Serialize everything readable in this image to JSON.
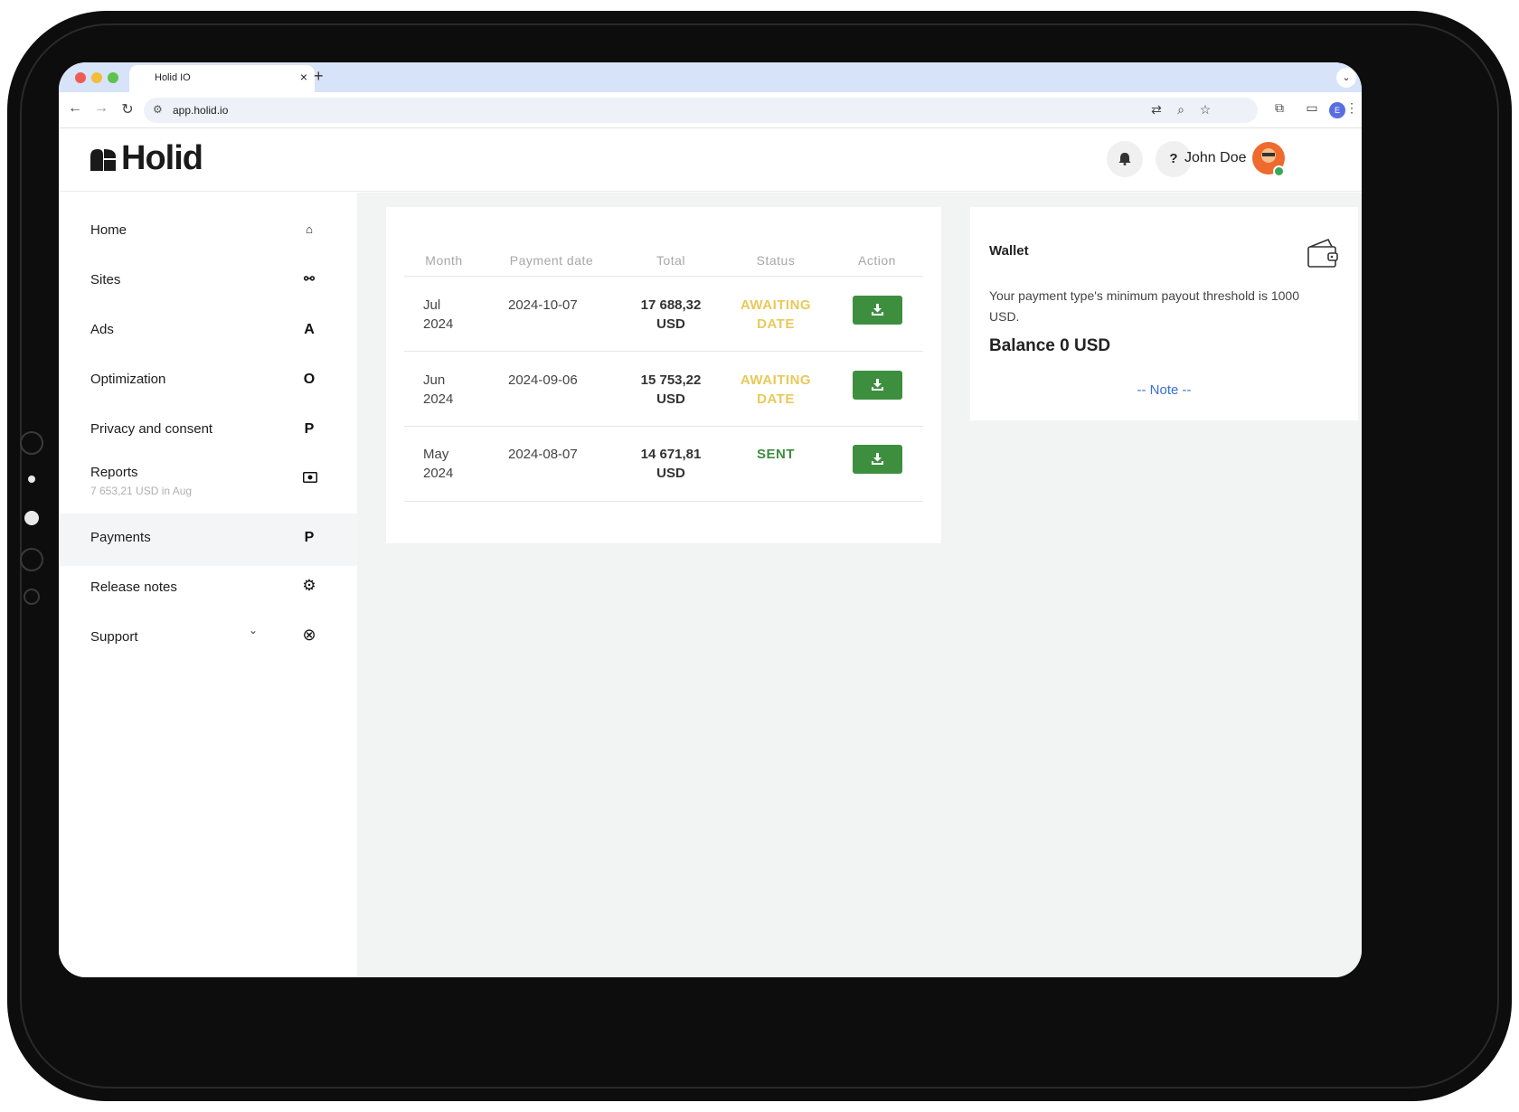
{
  "browser": {
    "tab_title": "Holid IO",
    "tab_close": "×",
    "new_tab": "+",
    "tab_menu": "⌄",
    "url": "app.holid.io",
    "profile_initial": "E"
  },
  "header": {
    "logo_text": "Holid",
    "notifications_icon": "bell-icon",
    "help_label": "?",
    "user_name": "John Doe"
  },
  "sidebar": {
    "items": [
      {
        "label": "Home",
        "icon": "🏠"
      },
      {
        "label": "Sites",
        "icon": "🔗"
      },
      {
        "label": "Ads",
        "icon": "A"
      },
      {
        "label": "Optimization",
        "icon": "O"
      },
      {
        "label": "Privacy and consent",
        "icon": "P"
      },
      {
        "label": "Reports",
        "sublabel": "7 653,21 USD in Aug",
        "icon": "💵"
      },
      {
        "label": "Payments",
        "icon": "P",
        "active": true
      },
      {
        "label": "Release notes",
        "icon": "⚙"
      },
      {
        "label": "Support",
        "icon": "⊛",
        "chevron": "⌄"
      }
    ]
  },
  "payments": {
    "columns": [
      "Month",
      "Payment date",
      "Total",
      "Status",
      "Action"
    ],
    "rows": [
      {
        "month": "Jul",
        "year": "2024",
        "date": "2024-10-07",
        "amount": "17 688,32",
        "currency": "USD",
        "status_line1": "AWAITING",
        "status_line2": "DATE",
        "status_color": "#e8c95a"
      },
      {
        "month": "Jun",
        "year": "2024",
        "date": "2024-09-06",
        "amount": "15 753,22",
        "currency": "USD",
        "status_line1": "AWAITING",
        "status_line2": "DATE",
        "status_color": "#e8c95a"
      },
      {
        "month": "May",
        "year": "2024",
        "date": "2024-08-07",
        "amount": "14 671,81",
        "currency": "USD",
        "status_line1": "SENT",
        "status_line2": "",
        "status_color": "#3d8f3f"
      }
    ]
  },
  "wallet": {
    "title": "Wallet",
    "threshold_text": "Your payment type's minimum payout threshold is 1000 USD.",
    "balance": "Balance 0 USD",
    "note_link": "-- Note --"
  },
  "colors": {
    "accent_green": "#3d8f3f",
    "awaiting_yellow": "#e8c95a",
    "link_blue": "#3a6fd8"
  }
}
